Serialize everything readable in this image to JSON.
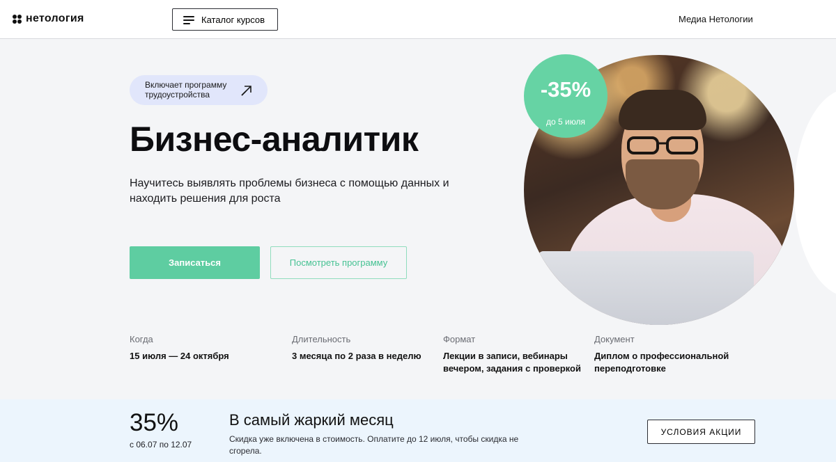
{
  "header": {
    "logo_text": "нетология",
    "catalog_label": "Каталог курсов",
    "media_label": "Медиа Нетологии"
  },
  "hero": {
    "badge_text": "Включает программу трудоустройства",
    "title": "Бизнес-аналитик",
    "subtitle": "Научитесь выявлять проблемы бизнеса с помощью данных и находить решения для роста",
    "primary_button": "Записаться",
    "secondary_button": "Посмотреть программу",
    "discount": {
      "value": "-35%",
      "until": "до 5 июля",
      "color": "#66d3a4"
    }
  },
  "info": [
    {
      "label": "Когда",
      "value": "15 июля — 24 октября"
    },
    {
      "label": "Длительность",
      "value": "3 месяца по 2 раза в неделю"
    },
    {
      "label": "Формат",
      "value": "Лекции в записи, вебинары вечером, задания с проверкой"
    },
    {
      "label": "Документ",
      "value": "Диплом о профессиональной переподготовке"
    }
  ],
  "promo": {
    "percent": "35%",
    "dates": "с 06.07 по 12.07",
    "title": "В самый жаркий месяц",
    "description": "Скидка уже включена в стоимость. Оплатите до 12 июля, чтобы скидка не сгорела.",
    "button": "УСЛОВИЯ АКЦИИ"
  },
  "colors": {
    "accent": "#5ecda1",
    "badge_bg": "#e1e6fb",
    "promo_bg": "#ecf5fd"
  },
  "icons": {
    "logo": "logo-mark-icon",
    "catalog": "menu-icon",
    "badge": "arrow-up-right-icon"
  }
}
